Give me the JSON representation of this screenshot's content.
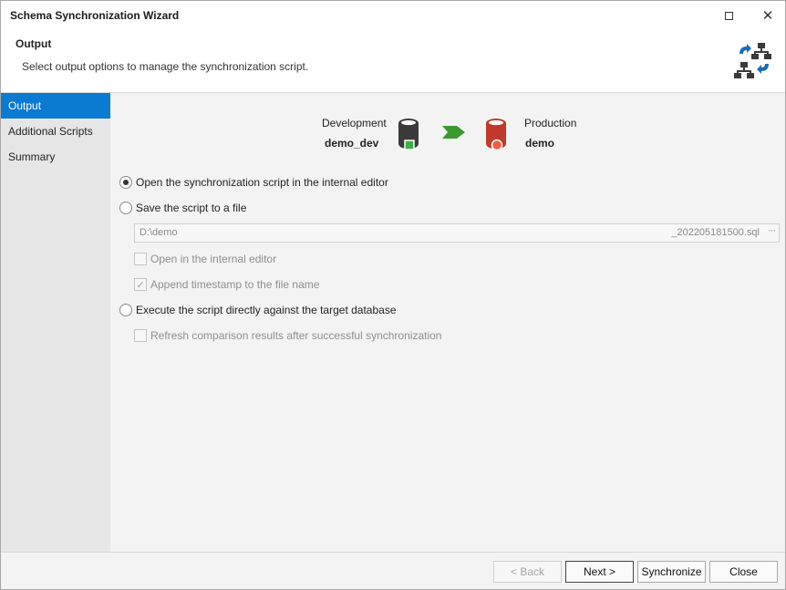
{
  "window": {
    "title": "Schema Synchronization Wizard",
    "maximize_icon": "maximize-icon",
    "close_icon": "close-icon"
  },
  "header": {
    "title": "Output",
    "description": "Select output options to manage the synchronization script.",
    "icon": "schema-sync-icon"
  },
  "sidebar": {
    "items": [
      {
        "label": "Output",
        "active": true
      },
      {
        "label": "Additional Scripts",
        "active": false
      },
      {
        "label": "Summary",
        "active": false
      }
    ]
  },
  "sync": {
    "source": {
      "label": "Development",
      "name": "demo_dev",
      "icon": "database-icon",
      "status_color": "#3cb043"
    },
    "target": {
      "label": "Production",
      "name": "demo",
      "icon": "database-icon",
      "status_color": "#f25c3c"
    },
    "arrow_color": "#3a9a2e"
  },
  "options": {
    "open_editor": "Open the synchronization script in the internal editor",
    "save_file": "Save the script to a file",
    "file_path": "D:\\demo",
    "file_suffix": "_202205181500.sql",
    "browse": "···",
    "open_internal": "Open in the internal editor",
    "append_timestamp": "Append timestamp to the file name",
    "execute": "Execute the script directly against the target database",
    "refresh": "Refresh comparison results after successful synchronization",
    "selected": "open_editor"
  },
  "footer": {
    "back": "< Back",
    "next": "Next >",
    "synchronize": "Synchronize",
    "close": "Close"
  },
  "colors": {
    "accent": "#0b7ad1",
    "icon_blue": "#1a6fb5",
    "icon_dark": "#3a3a3a"
  }
}
